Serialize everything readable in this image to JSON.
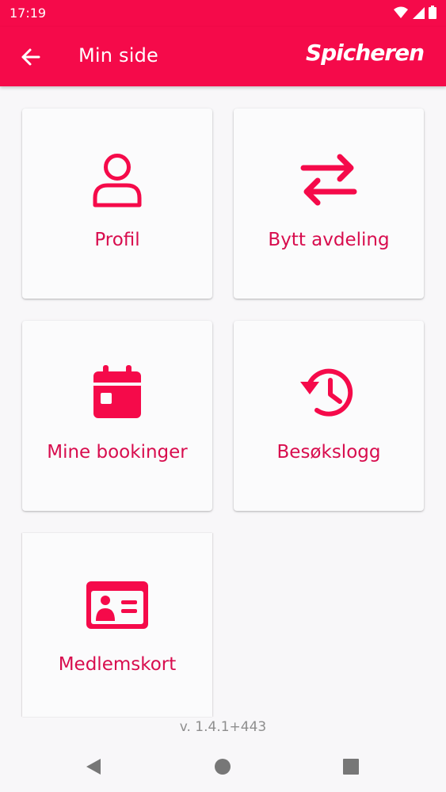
{
  "status": {
    "time": "17:19"
  },
  "header": {
    "title": "Min side",
    "logo": "Spicheren",
    "back_icon": "arrow-left-icon"
  },
  "accent_color": "#f50a4a",
  "tile_text_color": "#d80d4e",
  "tiles": [
    {
      "label": "Profil",
      "icon": "person-icon"
    },
    {
      "label": "Bytt avdeling",
      "icon": "swap-arrows-icon"
    },
    {
      "label": "Mine bookinger",
      "icon": "calendar-icon"
    },
    {
      "label": "Besøkslogg",
      "icon": "history-icon"
    },
    {
      "label": "Medlemskort",
      "icon": "id-card-icon"
    }
  ],
  "footer": {
    "version": "v. 1.4.1+443"
  }
}
